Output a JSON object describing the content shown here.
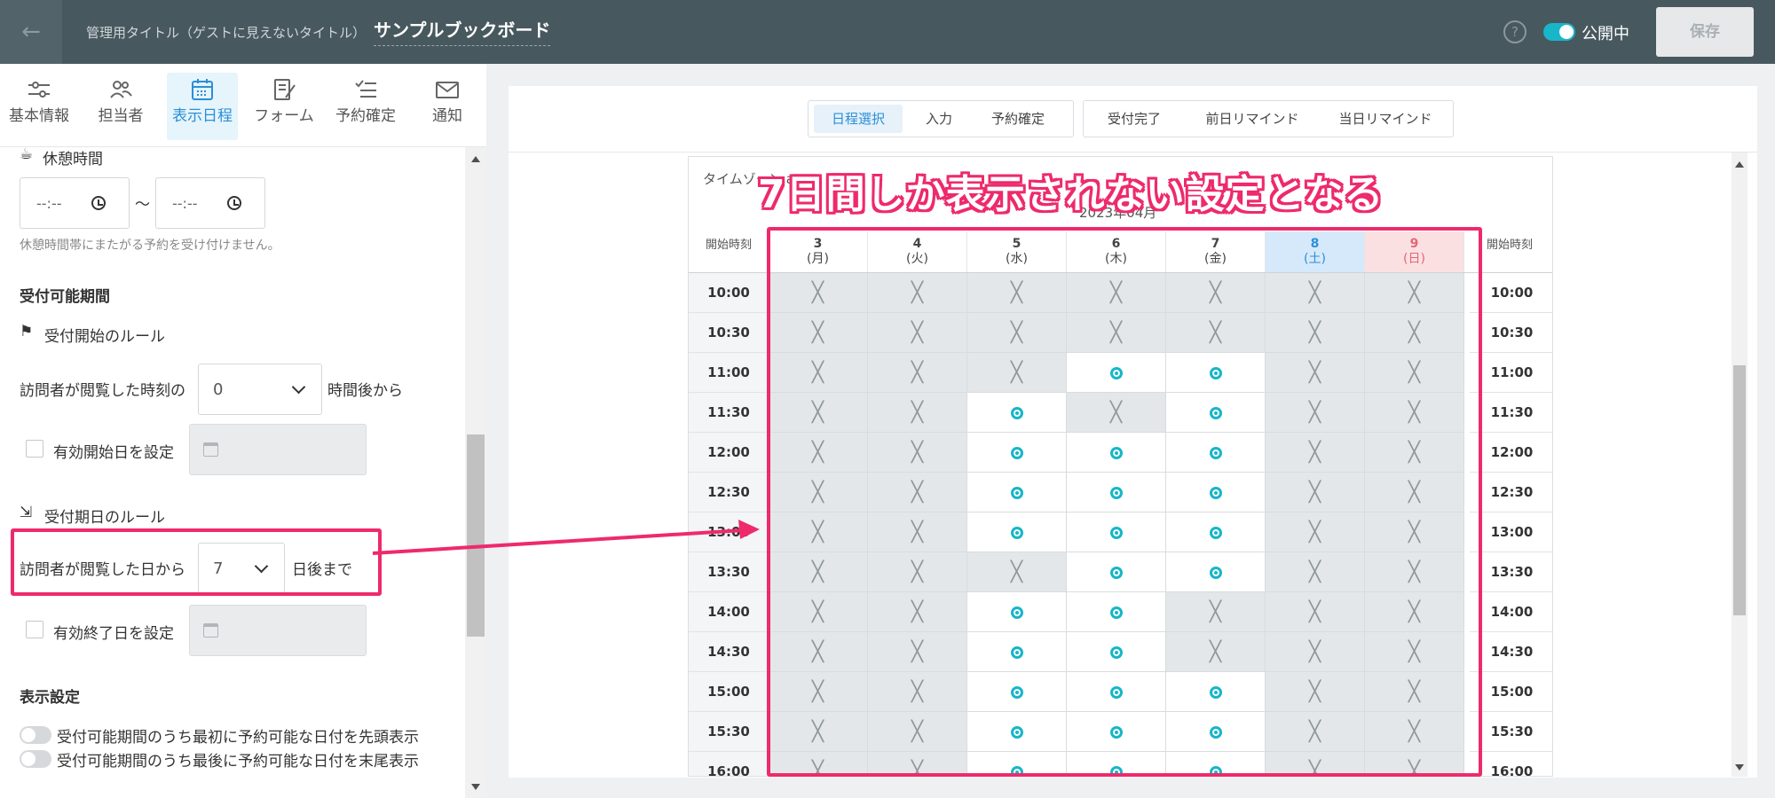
{
  "header": {
    "back_icon": "arrow-left-icon",
    "title_caption": "管理用タイトル（ゲストに見えないタイトル）",
    "title": "サンプルブックボード",
    "help": "?",
    "publish_label": "公開中",
    "save_label": "保存"
  },
  "tabs": [
    {
      "label": "基本情報",
      "icon": "sliders-icon"
    },
    {
      "label": "担当者",
      "icon": "users-icon"
    },
    {
      "label": "表示日程",
      "icon": "calendar-icon"
    },
    {
      "label": "フォーム",
      "icon": "form-icon"
    },
    {
      "label": "予約確定",
      "icon": "checklist-icon"
    },
    {
      "label": "通知",
      "icon": "mail-icon"
    }
  ],
  "active_tab": "表示日程",
  "settings": {
    "break_title": "休憩時間",
    "break_from_placeholder": "--:--",
    "break_tilde": "～",
    "break_to_placeholder": "--:--",
    "break_note": "休憩時間帯にまたがる予約を受け付けません。",
    "period_title": "受付可能期間",
    "start_rule_title": "受付開始のルール",
    "start_prefix": "訪問者が閲覧した時刻の",
    "start_value": "0",
    "start_suffix": "時間後から",
    "start_date_label": "有効開始日を設定",
    "end_rule_title": "受付期日のルール",
    "end_prefix": "訪問者が閲覧した日から",
    "end_value": "7",
    "end_suffix": "日後まで",
    "end_date_label": "有効終了日を設定",
    "display_title": "表示設定",
    "display_first": "受付可能期間のうち最初に予約可能な日付を先頭表示",
    "display_last": "受付可能期間のうち最後に予約可能な日付を末尾表示"
  },
  "preview_tabs_group1": [
    "日程選択",
    "入力",
    "予約確定"
  ],
  "preview_tabs_group2": [
    "受付完了",
    "前日リマインド",
    "当日リマインド"
  ],
  "calendar": {
    "timezone_label": "タイムゾーン",
    "timezone_value": "a",
    "month": "2023年04月",
    "start_time_header": "開始時刻",
    "days": [
      {
        "date": "3",
        "dow": "(月)"
      },
      {
        "date": "4",
        "dow": "(火)"
      },
      {
        "date": "5",
        "dow": "(水)"
      },
      {
        "date": "6",
        "dow": "(木)"
      },
      {
        "date": "7",
        "dow": "(金)"
      },
      {
        "date": "8",
        "dow": "(土)"
      },
      {
        "date": "9",
        "dow": "(日)"
      }
    ],
    "times": [
      "10:00",
      "10:30",
      "11:00",
      "11:30",
      "12:00",
      "12:30",
      "13:00",
      "13:30",
      "14:00",
      "14:30",
      "15:00",
      "15:30",
      "16:00"
    ],
    "slots": [
      [
        "x",
        "x",
        "x",
        "x",
        "x",
        "x",
        "x"
      ],
      [
        "x",
        "x",
        "x",
        "x",
        "x",
        "x",
        "x"
      ],
      [
        "x",
        "x",
        "x",
        "o",
        "o",
        "x",
        "x"
      ],
      [
        "x",
        "x",
        "o",
        "x",
        "o",
        "x",
        "x"
      ],
      [
        "x",
        "x",
        "o",
        "o",
        "o",
        "x",
        "x"
      ],
      [
        "x",
        "x",
        "o",
        "o",
        "o",
        "x",
        "x"
      ],
      [
        "x",
        "x",
        "o",
        "o",
        "o",
        "x",
        "x"
      ],
      [
        "x",
        "x",
        "x",
        "o",
        "o",
        "x",
        "x"
      ],
      [
        "x",
        "x",
        "o",
        "o",
        "x",
        "x",
        "x"
      ],
      [
        "x",
        "x",
        "o",
        "o",
        "x",
        "x",
        "x"
      ],
      [
        "x",
        "x",
        "o",
        "o",
        "o",
        "x",
        "x"
      ],
      [
        "x",
        "x",
        "o",
        "o",
        "o",
        "x",
        "x"
      ],
      [
        "x",
        "x",
        "o",
        "o",
        "o",
        "x",
        "x"
      ]
    ],
    "colors": {
      "accent": "#17b6c8",
      "saturday": "#2b8fd6",
      "sunday": "#e26676",
      "highlight": "#ee2a6b"
    }
  },
  "annotation": "7日間しか表示されない設定となる"
}
